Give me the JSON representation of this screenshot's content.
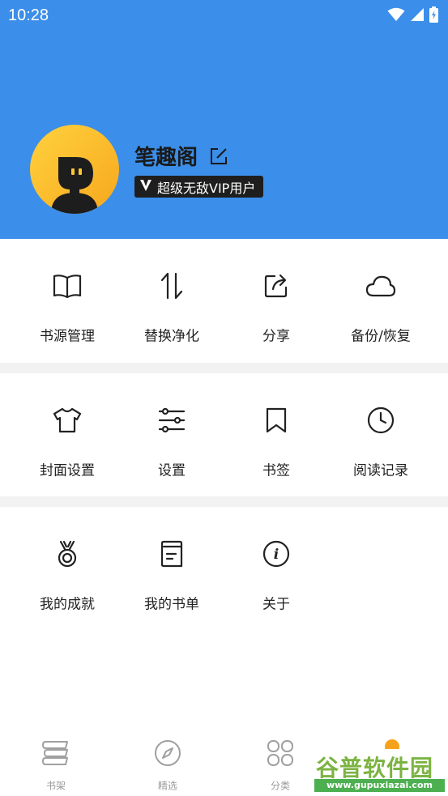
{
  "status_bar": {
    "time": "10:28"
  },
  "profile": {
    "username": "笔趣阁",
    "vip_label": "超级无敌VIP用户"
  },
  "sections": [
    {
      "items": [
        {
          "label": "书源管理",
          "icon": "book-open-icon"
        },
        {
          "label": "替换净化",
          "icon": "swap-arrows-icon"
        },
        {
          "label": "分享",
          "icon": "share-icon"
        },
        {
          "label": "备份/恢复",
          "icon": "cloud-icon"
        }
      ]
    },
    {
      "items": [
        {
          "label": "封面设置",
          "icon": "tshirt-icon"
        },
        {
          "label": "设置",
          "icon": "sliders-icon"
        },
        {
          "label": "书签",
          "icon": "bookmark-icon"
        },
        {
          "label": "阅读记录",
          "icon": "clock-icon"
        }
      ]
    },
    {
      "items": [
        {
          "label": "我的成就",
          "icon": "medal-icon"
        },
        {
          "label": "我的书单",
          "icon": "booklist-icon"
        },
        {
          "label": "关于",
          "icon": "info-icon"
        }
      ]
    }
  ],
  "bottom_nav": {
    "items": [
      {
        "label": "书架",
        "icon": "bookshelf-icon"
      },
      {
        "label": "精选",
        "icon": "compass-icon"
      },
      {
        "label": "分类",
        "icon": "category-icon"
      }
    ]
  },
  "watermark": {
    "title": "谷普软件园",
    "url": "www.gupuxiazai.com"
  },
  "colors": {
    "header": "#3b8ee9",
    "avatar": "#ffc52e",
    "badge": "#1e1e1e",
    "divider": "#f2f2f2"
  }
}
